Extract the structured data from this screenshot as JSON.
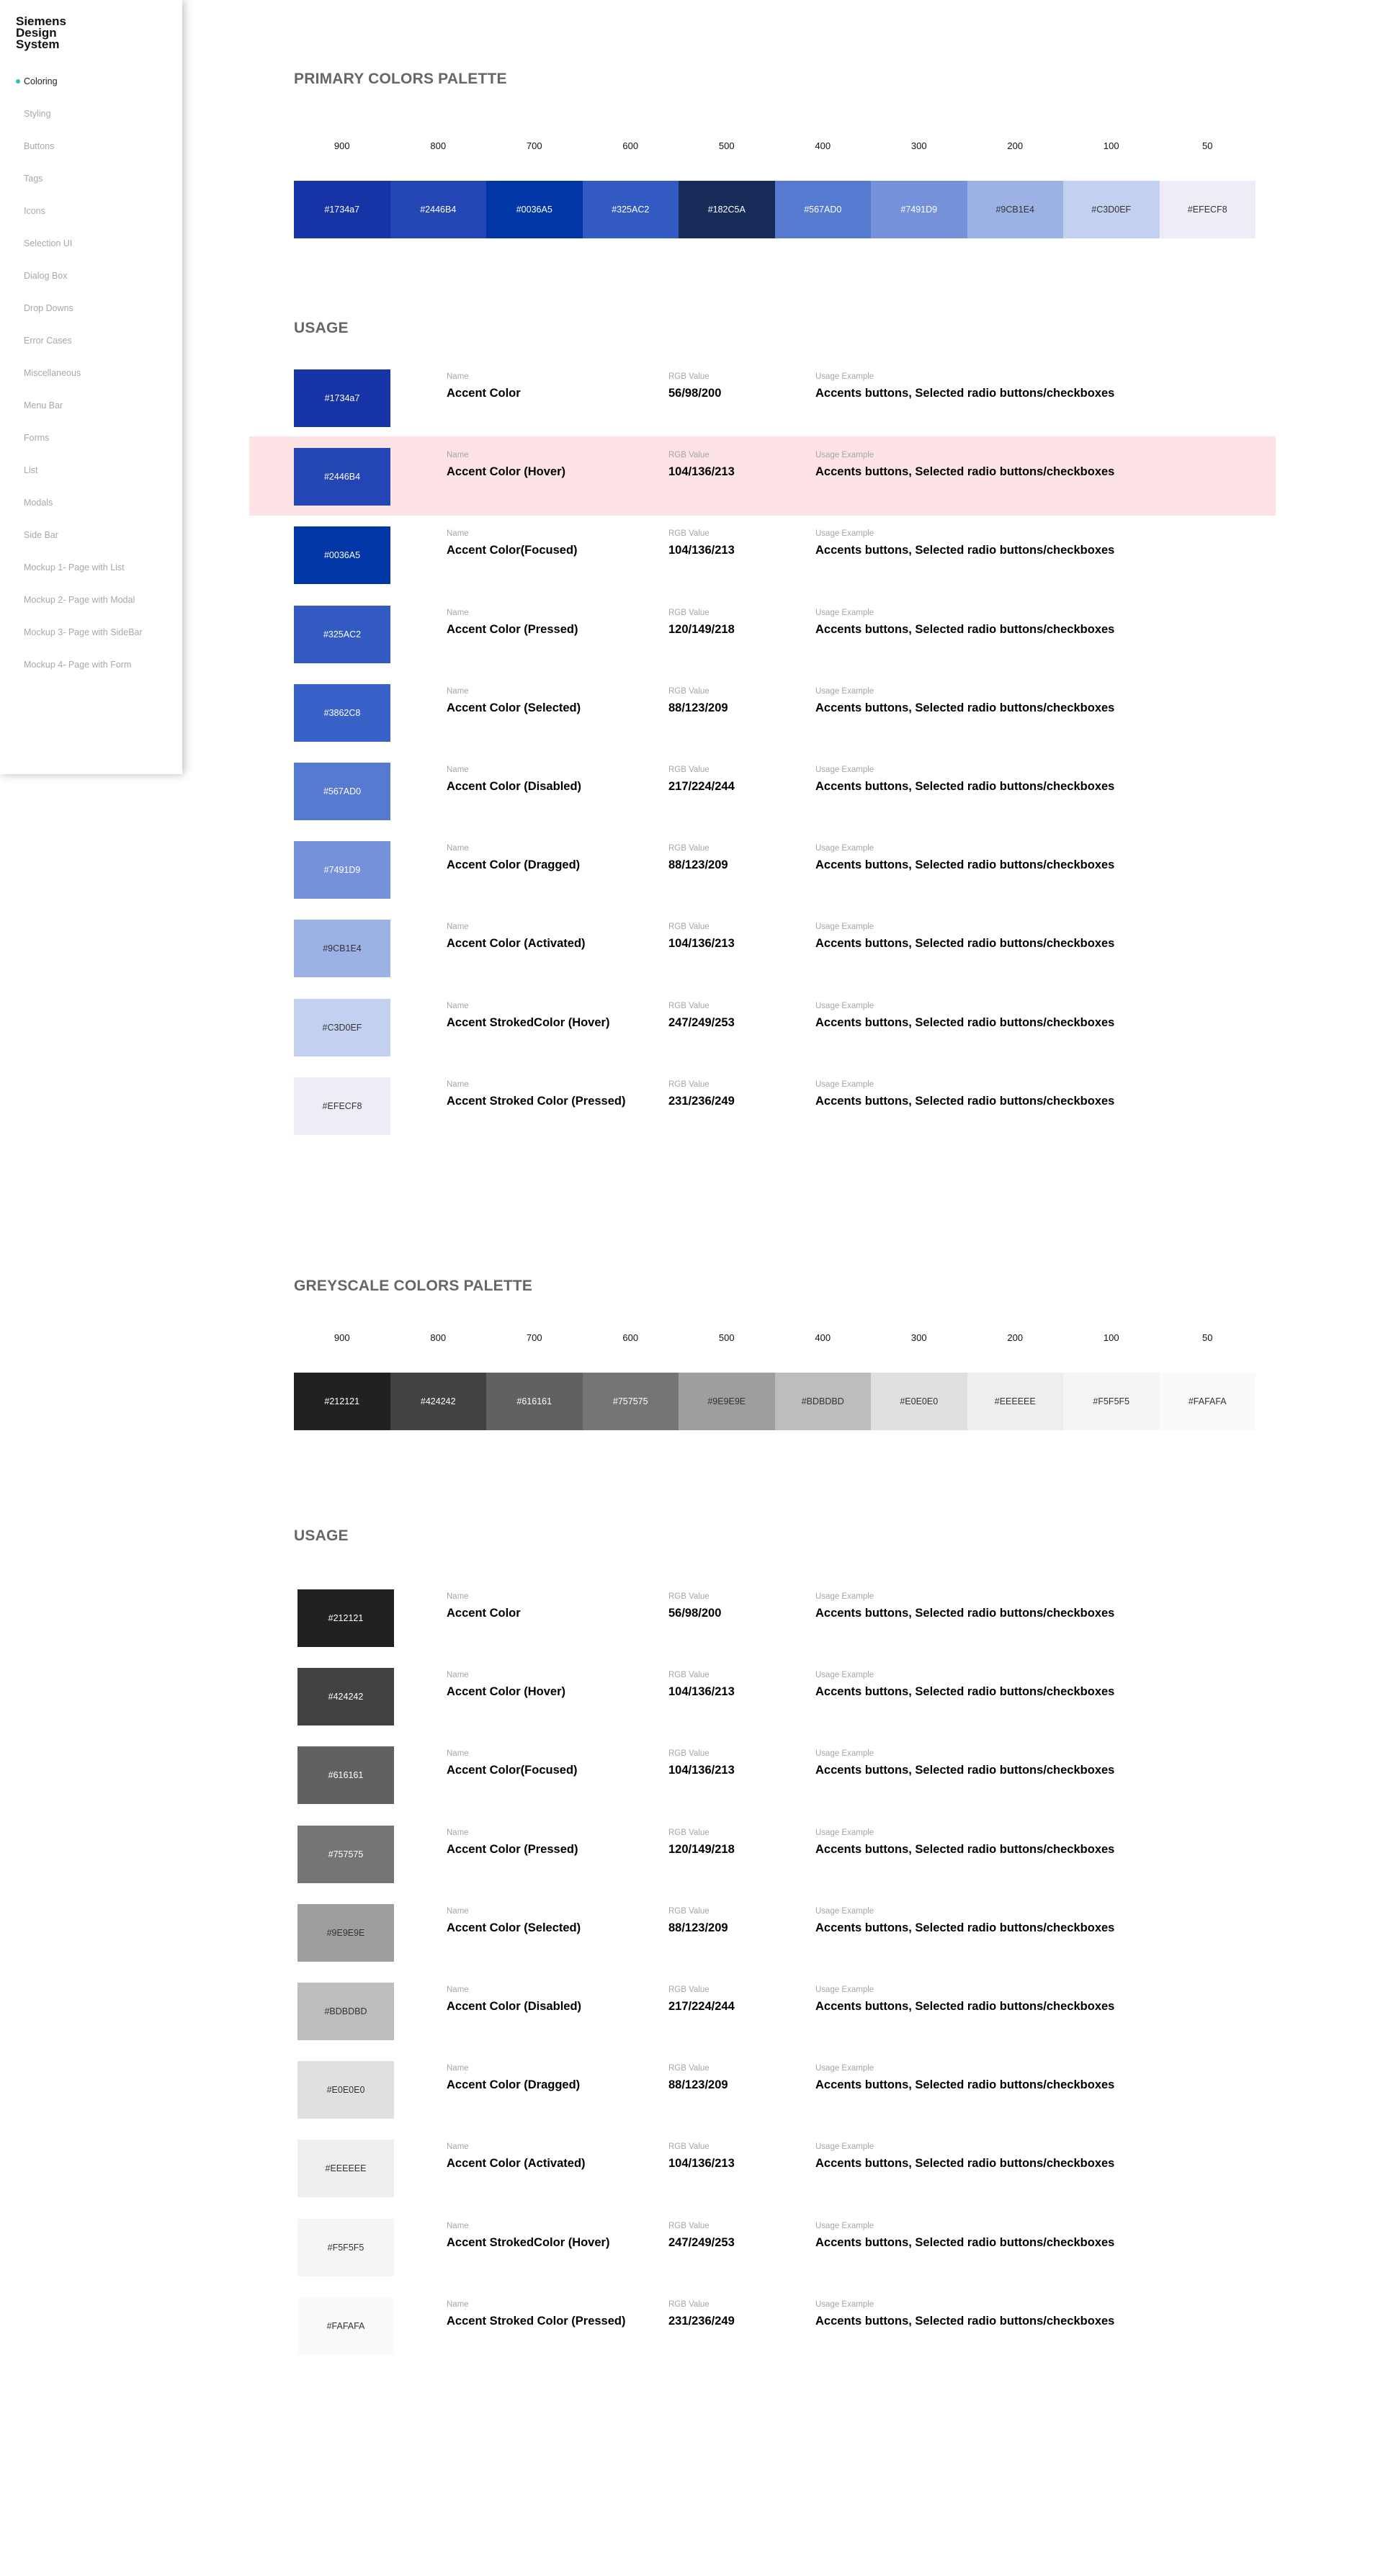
{
  "sidebar": {
    "brand": "Siemens\nDesign\nSystem",
    "items": [
      {
        "label": "Coloring",
        "active": true
      },
      {
        "label": "Styling"
      },
      {
        "label": "Buttons"
      },
      {
        "label": "Tags"
      },
      {
        "label": "Icons"
      },
      {
        "label": "Selection UI"
      },
      {
        "label": "Dialog Box"
      },
      {
        "label": "Drop Downs"
      },
      {
        "label": "Error Cases"
      },
      {
        "label": "Miscellaneous"
      },
      {
        "label": "Menu Bar"
      },
      {
        "label": "Forms"
      },
      {
        "label": "List"
      },
      {
        "label": "Modals"
      },
      {
        "label": "Side Bar"
      },
      {
        "label": "Mockup 1- Page with List"
      },
      {
        "label": "Mockup 2- Page with Modal"
      },
      {
        "label": "Mockup 3- Page with SideBar"
      },
      {
        "label": "Mockup 4- Page with Form"
      }
    ]
  },
  "primary": {
    "title": "PRIMARY COLORS PALETTE",
    "usage_title": "USAGE",
    "steps": [
      {
        "label": "900",
        "hex": "#1734a7"
      },
      {
        "label": "800",
        "hex": "#2446B4"
      },
      {
        "label": "700",
        "hex": "#0036A5"
      },
      {
        "label": "600",
        "hex": "#325AC2"
      },
      {
        "label": "500",
        "hex": "#182C5A"
      },
      {
        "label": "400",
        "hex": "#567AD0"
      },
      {
        "label": "300",
        "hex": "#7491D9"
      },
      {
        "label": "200",
        "hex": "#9CB1E4"
      },
      {
        "label": "100",
        "hex": "#C3D0EF"
      },
      {
        "label": "50",
        "hex": "#EFECF8"
      }
    ],
    "usage": [
      {
        "hex": "#1734a7",
        "name": "Accent Color",
        "rgb": "56/98/200",
        "example": "Accents buttons, Selected radio buttons/checkboxes"
      },
      {
        "hex": "#2446B4",
        "name": "Accent Color (Hover)",
        "rgb": "104/136/213",
        "example": "Accents buttons, Selected radio buttons/checkboxes",
        "highlight": true
      },
      {
        "hex": "#0036A5",
        "name": "Accent Color(Focused)",
        "rgb": "104/136/213",
        "example": "Accents buttons, Selected radio buttons/checkboxes"
      },
      {
        "hex": "#325AC2",
        "name": "Accent Color (Pressed)",
        "rgb": "120/149/218",
        "example": "Accents buttons, Selected radio buttons/checkboxes"
      },
      {
        "hex": "#3862C8",
        "name": "Accent Color (Selected)",
        "rgb": "88/123/209",
        "example": "Accents buttons, Selected radio buttons/checkboxes"
      },
      {
        "hex": "#567AD0",
        "name": "Accent Color (Disabled)",
        "rgb": "217/224/244",
        "example": "Accents buttons, Selected radio buttons/checkboxes"
      },
      {
        "hex": "#7491D9",
        "name": "Accent Color (Dragged)",
        "rgb": "88/123/209",
        "example": "Accents buttons, Selected radio buttons/checkboxes"
      },
      {
        "hex": "#9CB1E4",
        "name": "Accent Color (Activated)",
        "rgb": "104/136/213",
        "example": "Accents buttons, Selected radio buttons/checkboxes"
      },
      {
        "hex": "#C3D0EF",
        "name": "Accent StrokedColor (Hover)",
        "rgb": "247/249/253",
        "example": "Accents buttons, Selected radio buttons/checkboxes"
      },
      {
        "hex": "#EFECF8",
        "name": "Accent Stroked Color (Pressed)",
        "rgb": "231/236/249",
        "example": "Accents buttons, Selected radio buttons/checkboxes"
      }
    ]
  },
  "greyscale": {
    "title": "GREYSCALE COLORS PALETTE",
    "usage_title": "USAGE",
    "steps": [
      {
        "label": "900",
        "hex": "#212121"
      },
      {
        "label": "800",
        "hex": "#424242"
      },
      {
        "label": "700",
        "hex": "#616161"
      },
      {
        "label": "600",
        "hex": "#757575"
      },
      {
        "label": "500",
        "hex": "#9E9E9E"
      },
      {
        "label": "400",
        "hex": "#BDBDBD"
      },
      {
        "label": "300",
        "hex": "#E0E0E0"
      },
      {
        "label": "200",
        "hex": "#EEEEEE"
      },
      {
        "label": "100",
        "hex": "#F5F5F5"
      },
      {
        "label": "50",
        "hex": "#FAFAFA"
      }
    ],
    "usage": [
      {
        "hex": "#212121",
        "name": "Accent Color",
        "rgb": "56/98/200",
        "example": "Accents buttons, Selected radio buttons/checkboxes"
      },
      {
        "hex": "#424242",
        "name": "Accent Color (Hover)",
        "rgb": "104/136/213",
        "example": "Accents buttons, Selected radio buttons/checkboxes"
      },
      {
        "hex": "#616161",
        "name": "Accent Color(Focused)",
        "rgb": "104/136/213",
        "example": "Accents buttons, Selected radio buttons/checkboxes"
      },
      {
        "hex": "#757575",
        "name": "Accent Color (Pressed)",
        "rgb": "120/149/218",
        "example": "Accents buttons, Selected radio buttons/checkboxes"
      },
      {
        "hex": "#9E9E9E",
        "name": "Accent Color (Selected)",
        "rgb": "88/123/209",
        "example": "Accents buttons, Selected radio buttons/checkboxes"
      },
      {
        "hex": "#BDBDBD",
        "name": "Accent Color (Disabled)",
        "rgb": "217/224/244",
        "example": "Accents buttons, Selected radio buttons/checkboxes"
      },
      {
        "hex": "#E0E0E0",
        "name": "Accent Color (Dragged)",
        "rgb": "88/123/209",
        "example": "Accents buttons, Selected radio buttons/checkboxes"
      },
      {
        "hex": "#EEEEEE",
        "name": "Accent Color (Activated)",
        "rgb": "104/136/213",
        "example": "Accents buttons, Selected radio buttons/checkboxes"
      },
      {
        "hex": "#F5F5F5",
        "name": "Accent StrokedColor (Hover)",
        "rgb": "247/249/253",
        "example": "Accents buttons, Selected radio buttons/checkboxes"
      },
      {
        "hex": "#FAFAFA",
        "name": "Accent Stroked Color (Pressed)",
        "rgb": "231/236/249",
        "example": "Accents buttons, Selected radio buttons/checkboxes"
      }
    ]
  },
  "columns": {
    "name": "Name",
    "rgb": "RGB Value",
    "example": "Usage Example"
  },
  "colors": {
    "active_dot": "#2ec4b6",
    "highlight_row": "#fde3e5",
    "section_title": "#666666"
  }
}
